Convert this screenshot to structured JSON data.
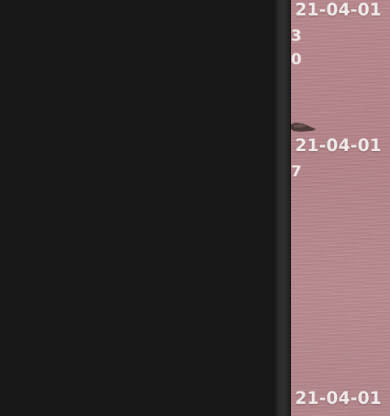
{
  "thumbnail_column": {
    "photo_labels": [
      "21-04-01",
      "21-04-01",
      "21-04-01"
    ],
    "label_fragments": [
      "3",
      "0",
      "7"
    ]
  },
  "colors": {
    "dark_pane": "#171717",
    "divider": "#2a2a2a",
    "photo_tint": "#b6878c",
    "label_text": "#f1eaeb"
  }
}
